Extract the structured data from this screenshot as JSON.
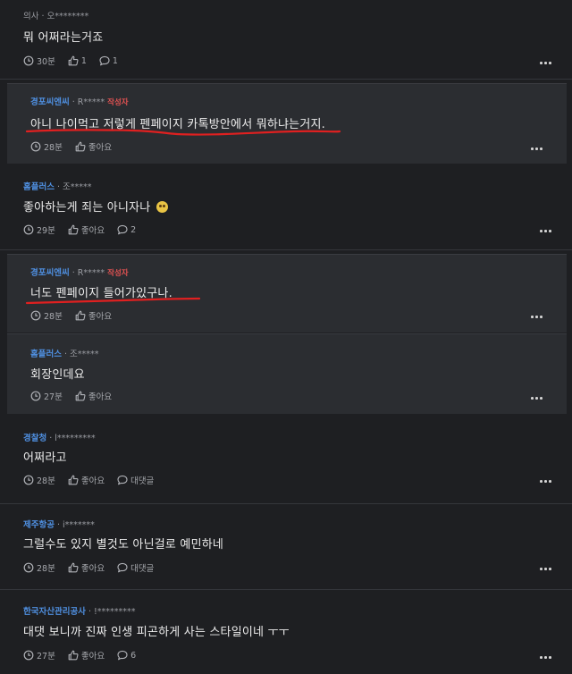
{
  "comments": [
    {
      "company": "의사",
      "user": "오********",
      "text": "뭐 어쩌라는거죠",
      "time": "30분",
      "likes": "1",
      "replies": "1",
      "is_reply": false
    },
    {
      "company": "경포씨엔씨",
      "user": "R*****",
      "badge": "작성자",
      "text": "아니 나이먹고 저렇게 펜페이지 카톡방안에서 뭐하냐는거지.",
      "time": "28분",
      "likes": "좋아요",
      "is_reply": true
    },
    {
      "company": "홈플러스",
      "user": "조*****",
      "text": "좋아하는게 죄는 아니자나",
      "time": "29분",
      "likes": "좋아요",
      "replies": "2",
      "is_reply": false
    },
    {
      "company": "경포씨엔씨",
      "user": "R*****",
      "badge": "작성자",
      "text": "너도 펜페이지 들어가있구나.",
      "time": "28분",
      "likes": "좋아요",
      "is_reply": true
    },
    {
      "company": "홈플러스",
      "user": "조*****",
      "text": "회장인데요",
      "time": "27분",
      "likes": "좋아요",
      "is_reply": true
    },
    {
      "company": "경찰청",
      "user": "l*********",
      "text": "어쩌라고",
      "time": "28분",
      "likes": "좋아요",
      "replies": "대댓글",
      "is_reply": false
    },
    {
      "company": "제주항공",
      "user": "i*******",
      "text": "그럴수도 있지 별것도 아닌걸로 예민하네",
      "time": "28분",
      "likes": "좋아요",
      "replies": "대댓글",
      "is_reply": false
    },
    {
      "company": "한국자산관리공사",
      "user": "!*********",
      "text": "대댓 보니까 진짜 인생 피곤하게 사는 스타일이네 ㅜㅜ",
      "time": "27분",
      "likes": "좋아요",
      "replies": "6",
      "is_reply": false
    }
  ],
  "colors": {
    "background": "#1e1f22",
    "reply_background": "#2b2d31",
    "company_link": "#4f8fe0",
    "author_badge": "#e05252",
    "highlight_underline": "#e02020"
  },
  "icons": {
    "time": "clock-icon",
    "like": "thumbs-up-icon",
    "reply": "speech-bubble-icon",
    "more": "more-dots-icon",
    "emoji": "crying-face-emoji"
  }
}
